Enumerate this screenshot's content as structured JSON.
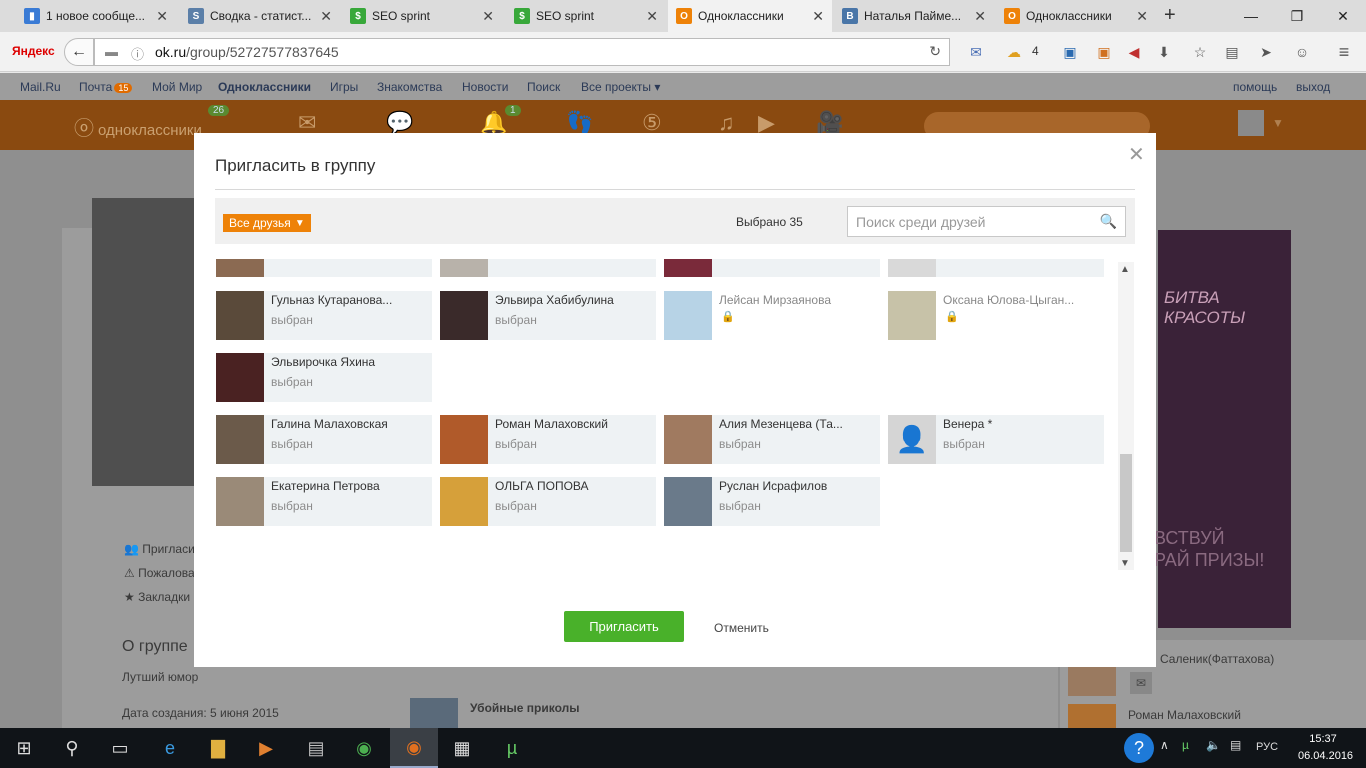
{
  "browser": {
    "tabs": [
      {
        "title": "1 новое сообще...",
        "icon": "chart-icon",
        "color": "#3a7bd5"
      },
      {
        "title": "Сводка - статист...",
        "icon": "sp-icon",
        "color": "#5b7fa8"
      },
      {
        "title": "SEO sprint",
        "icon": "seo-sprint-icon",
        "color": "#38a83a"
      },
      {
        "title": "SEO sprint",
        "icon": "seo-sprint-icon",
        "color": "#38a83a"
      },
      {
        "title": "Одноклассники",
        "icon": "ok-icon",
        "color": "#ee8208"
      },
      {
        "title": "Наталья Пайме...",
        "icon": "vk-icon",
        "color": "#4a76a8"
      },
      {
        "title": "Одноклассники",
        "icon": "ok-icon",
        "color": "#ee8208"
      }
    ],
    "new_tab": "+",
    "yandex_label": "Яндекс",
    "url_host": "ok.ru",
    "url_path": "/group/52727577837645",
    "weather_temp": "4"
  },
  "mailru_bar": {
    "links": [
      "Mail.Ru",
      "Почта",
      "Мой Мир",
      "Одноклассники",
      "Игры",
      "Знакомства",
      "Новости",
      "Поиск",
      "Все проекты ▾"
    ],
    "mail_badge": "15",
    "help": "помощь",
    "logout": "выход"
  },
  "ok_header": {
    "logo_text": "одноклассники",
    "badge_messages": "26",
    "badge_events": "1"
  },
  "background_page": {
    "actions": [
      "Пригласить",
      "Пожаловаться",
      "Закладки"
    ],
    "about_title": "О группе",
    "about_text": "Лутший юмор",
    "created": "Дата создания: 5 июня 2015",
    "feed_title": "Убойные приколы",
    "right_user_1": "Саленик(Фаттахова)",
    "right_user_2": "Роман Малаховский",
    "ad_line_1": "БИТВА",
    "ad_line_2": "КРАСОТЫ",
    "ad_line_3": "ВСТВУЙ",
    "ad_line_4": "РАЙ ПРИЗЫ!"
  },
  "modal": {
    "title": "Пригласить в группу",
    "filter_label": "Все друзья",
    "selected_text": "Выбрано 35",
    "search_placeholder": "Поиск среди друзей",
    "invite_button": "Пригласить",
    "cancel_button": "Отменить",
    "friends": [
      {
        "name": "",
        "status": "",
        "photo": "#8b6a52",
        "locked": false,
        "plain": false
      },
      {
        "name": "",
        "status": "",
        "photo": "#b8b2aa",
        "locked": false,
        "plain": false
      },
      {
        "name": "",
        "status": "",
        "photo": "#7a2a3a",
        "locked": false,
        "plain": false
      },
      {
        "name": "",
        "status": "",
        "photo": "#d9d9d9",
        "locked": false,
        "plain": false
      },
      {
        "name": "Гульназ Кутаранова...",
        "status": "выбран",
        "photo": "#5a4a3a",
        "locked": false,
        "plain": false
      },
      {
        "name": "Эльвира Хабибулина",
        "status": "выбран",
        "photo": "#3a2a2a",
        "locked": false,
        "plain": false
      },
      {
        "name": "Лейсан Мирзаянова",
        "status": "",
        "photo": "#b7d3e6",
        "locked": true,
        "plain": true
      },
      {
        "name": "Оксана Юлова-Цыган...",
        "status": "",
        "photo": "#c7c2a8",
        "locked": true,
        "plain": true
      },
      {
        "name": "Эльвирочка Яхина",
        "status": "выбран",
        "photo": "#4a2222",
        "locked": false,
        "plain": false
      },
      {
        "name": "Галина Малаховская",
        "status": "выбран",
        "photo": "#6b5a4a",
        "locked": false,
        "plain": false
      },
      {
        "name": "Роман Малаховский",
        "status": "выбран",
        "photo": "#b05a2a",
        "locked": false,
        "plain": false
      },
      {
        "name": "Алия Мезенцева (Та...",
        "status": "выбран",
        "photo": "#a07a60",
        "locked": false,
        "plain": false
      },
      {
        "name": "Венера *",
        "status": "выбран",
        "photo": "#d5d5d5",
        "locked": false,
        "plain": false
      },
      {
        "name": "Екатерина Петрова",
        "status": "выбран",
        "photo": "#9a8a78",
        "locked": false,
        "plain": false
      },
      {
        "name": "ОЛЬГА ПОПОВА",
        "status": "выбран",
        "photo": "#d6a03a",
        "locked": false,
        "plain": false
      },
      {
        "name": "Руслан Исрафилов",
        "status": "выбран",
        "photo": "#6a7a8a",
        "locked": false,
        "plain": false
      }
    ]
  },
  "taskbar": {
    "lang": "РУС",
    "time": "15:37",
    "date": "06.04.2016",
    "help_icon": "?"
  }
}
